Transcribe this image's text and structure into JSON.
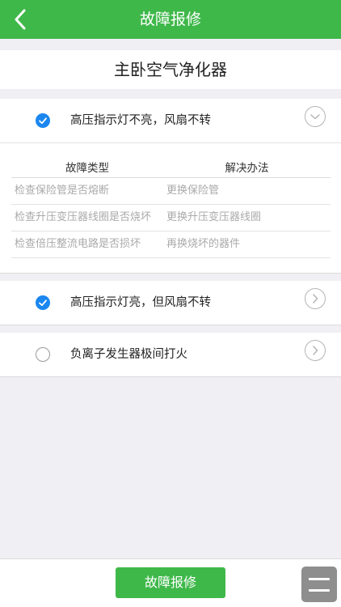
{
  "header": {
    "title": "故障报修"
  },
  "device": {
    "name": "主卧空气净化器"
  },
  "faults": [
    {
      "label": "高压指示灯不亮，风扇不转",
      "checked": true,
      "expanded": true,
      "detail": {
        "col_type": "故障类型",
        "col_solution": "解决办法",
        "rows": [
          {
            "type": "检查保险管是否熔断",
            "solution": "更换保险管"
          },
          {
            "type": "检查升压变压器线圈是否烧坏",
            "solution": "更换升压变压器线圈"
          },
          {
            "type": "检查倍压整流电路是否损坏",
            "solution": "再换烧坏的器件"
          }
        ]
      }
    },
    {
      "label": "高压指示灯亮，但风扇不转",
      "checked": true,
      "expanded": false
    },
    {
      "label": "负离子发生器极间打火",
      "checked": false,
      "expanded": false
    }
  ],
  "footer": {
    "submit_label": "故障报修"
  },
  "icons": {
    "back": "chevron-left-icon",
    "expand": "chevron-down-icon",
    "collapse": "chevron-right-icon",
    "menu": "menu-icon"
  },
  "colors": {
    "brand": "#3fb84a",
    "check": "#1a87f0",
    "background": "#efeff4"
  }
}
